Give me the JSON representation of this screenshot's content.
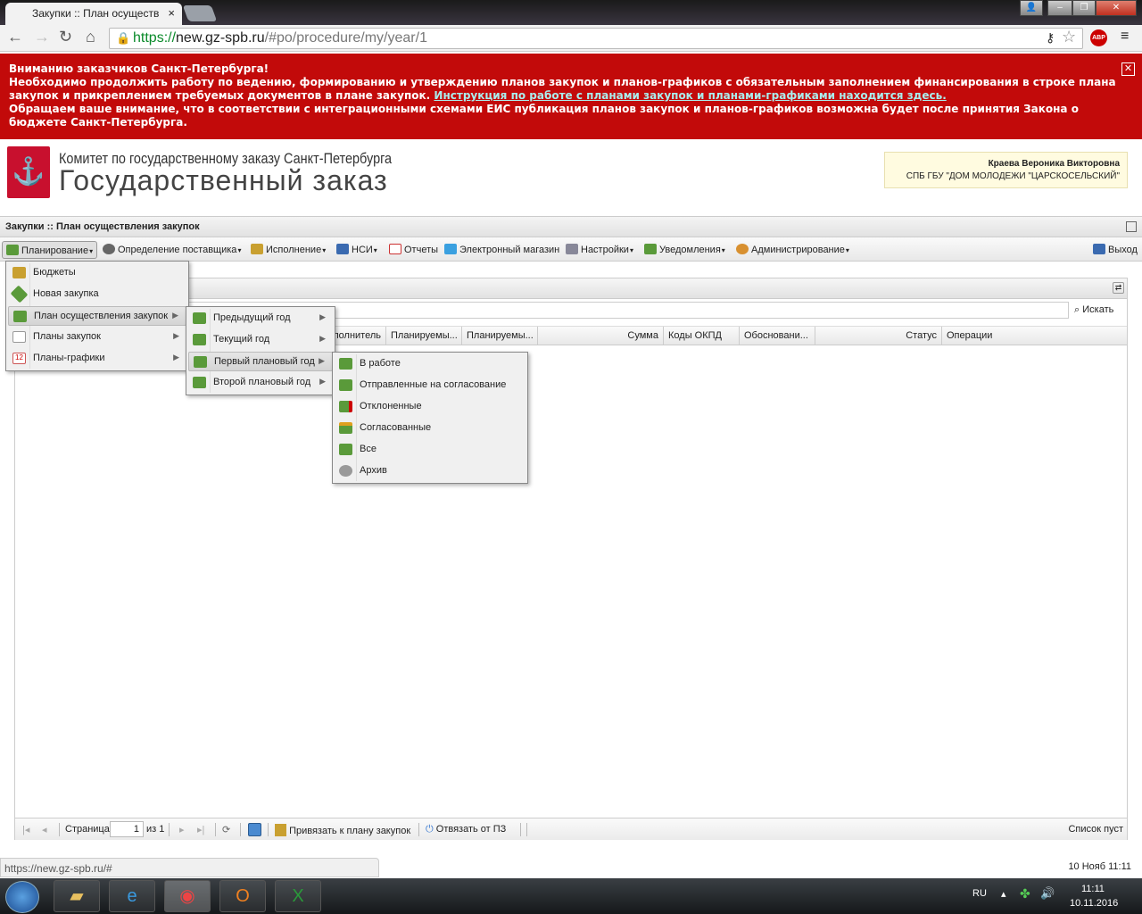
{
  "browser": {
    "tab_title": "Закупки :: План осуществ",
    "url_scheme": "https://",
    "url_host": "new.gz-spb.ru",
    "url_path": "/#po/procedure/my/year/1",
    "status_url": "https://new.gz-spb.ru/#"
  },
  "banner": {
    "line1": "Вниманию заказчиков Санкт-Петербурга!",
    "line2": "Необходимо продолжить работу по ведению, формированию и утверждению планов закупок и планов-графиков с обязательным заполнением финансирования в строке плана закупок и прикреплением требуемых документов в плане закупок.",
    "link": "Инструкция по работе с планами закупок и планами-графиками находится здесь.",
    "line3": "Обращаем ваше внимание, что в соответствии с интеграционными схемами ЕИС публикация планов закупок и планов-графиков возможна будет после принятия Закона о бюджете Санкт-Петербурга."
  },
  "header": {
    "org_line1": "Комитет по государственному заказу Санкт-Петербурга",
    "org_line2": "Государственный заказ",
    "user_name": "Краева Вероника Викторовна",
    "user_org": "СПБ ГБУ \"ДОМ МОЛОДЕЖИ \"ЦАРСКОСЕЛЬСКИЙ\""
  },
  "panel": {
    "title": "Закупки :: План осуществления закупок"
  },
  "menubar": {
    "items": [
      {
        "label": "Планирование"
      },
      {
        "label": "Определение поставщика"
      },
      {
        "label": "Исполнение"
      },
      {
        "label": "НСИ"
      },
      {
        "label": "Отчеты"
      },
      {
        "label": "Электронный магазин"
      },
      {
        "label": "Настройки"
      },
      {
        "label": "Уведомления"
      },
      {
        "label": "Администрирование"
      }
    ],
    "logout": "Выход"
  },
  "menu1": [
    {
      "label": "Бюджеты"
    },
    {
      "label": "Новая закупка"
    },
    {
      "label": "План осуществления закупок"
    },
    {
      "label": "Планы закупок"
    },
    {
      "label": "Планы-графики"
    }
  ],
  "menu2": [
    {
      "label": "Предыдущий год"
    },
    {
      "label": "Текущий год"
    },
    {
      "label": "Первый плановый год"
    },
    {
      "label": "Второй плановый год"
    }
  ],
  "menu3": [
    {
      "label": "В работе"
    },
    {
      "label": "Отправленные на согласование"
    },
    {
      "label": "Отклоненные"
    },
    {
      "label": "Согласованные"
    },
    {
      "label": "Все"
    },
    {
      "label": "Архив"
    }
  ],
  "grid": {
    "search_button": "Искать",
    "columns": [
      "Исполнитель",
      "Планируемы...",
      "Планируемы...",
      "Сумма",
      "Коды ОКПД",
      "Обосновани...",
      "Статус",
      "Операции"
    ]
  },
  "pager": {
    "page_label": "Страница",
    "page_value": "1",
    "of_label": "из 1",
    "bind_label": "Привязать к плану закупок",
    "unbind_label": "Отвязать от ПЗ",
    "empty_text": "Список пуст"
  },
  "statusbar": {
    "datetime": "10 Нояб 11:11"
  },
  "taskbar": {
    "lang": "RU",
    "time": "11:11",
    "date": "10.11.2016"
  }
}
